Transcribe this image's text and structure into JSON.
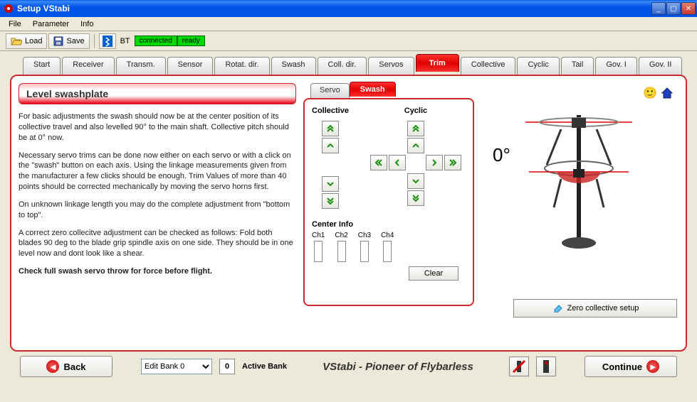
{
  "window": {
    "title": "Setup VStabi"
  },
  "menu": {
    "file": "File",
    "parameter": "Parameter",
    "info": "Info"
  },
  "toolbar": {
    "load": "Load",
    "save": "Save",
    "bt_label": "BT",
    "status_connected": "connected",
    "status_ready": "ready"
  },
  "tabs": [
    "Start",
    "Receiver",
    "Transm.",
    "Sensor",
    "Rotat. dir.",
    "Swash",
    "Coll. dir.",
    "Servos",
    "Trim",
    "Collective",
    "Cyclic",
    "Tail",
    "Gov. I",
    "Gov. II"
  ],
  "active_tab": "Trim",
  "left": {
    "heading": "Level swashplate",
    "p1": "For basic adjustments the swash should now be at the center position of its collective travel and also levelled  90° to the main shaft. Collective pitch should be at 0° now.",
    "p2": "Necessary servo trims can be done now either on each servo or with a click on the \"swash\" button on each axis. Using the linkage measurements given from the manufacturer a few clicks should be enough. Trim Values of more than 40 points should be corrected mechanically by moving the servo horns first.",
    "p3": "On unknown linkage length you may do the complete adjustment from \"bottom to top\".",
    "p4": "A correct zero collecitve adjustment can be checked as follows: Fold both blades 90 deg to the blade grip spindle axis on one side. They should be in one level now and dont look like a shear.",
    "p5": "Check full swash servo throw for force before flight."
  },
  "ctrl": {
    "tab_servo": "Servo",
    "tab_swash": "Swash",
    "collective_label": "Collective",
    "cyclic_label": "Cyclic",
    "center_info": "Center Info",
    "channels": [
      "Ch1",
      "Ch2",
      "Ch3",
      "Ch4"
    ],
    "clear": "Clear"
  },
  "viz": {
    "degree": "0°",
    "zero_btn": "Zero collective setup"
  },
  "footer": {
    "back": "Back",
    "continue": "Continue",
    "edit_bank": "Edit Bank 0",
    "active_bank_num": "0",
    "active_bank": "Active Bank",
    "tagline": "VStabi - Pioneer of Flybarless"
  }
}
